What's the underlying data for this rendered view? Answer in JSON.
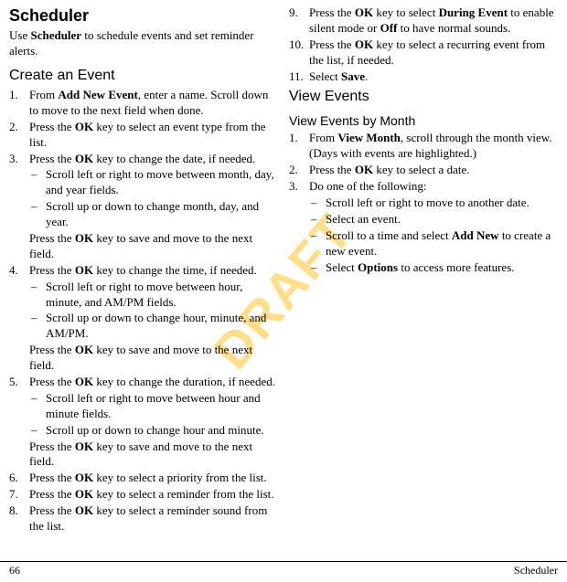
{
  "watermark": "DRAFT",
  "h1": "Scheduler",
  "intro_a": "Use ",
  "intro_b": "Scheduler",
  "intro_c": " to schedule events and set reminder alerts.",
  "h2_create": "Create an Event",
  "s1": {
    "num": "1.",
    "a": "From ",
    "b": "Add New Event",
    "c": ", enter a name. Scroll down to move to the next field when done."
  },
  "s2": {
    "num": "2.",
    "a": "Press the ",
    "b": "OK",
    "c": " key to select an event type from the list."
  },
  "s3": {
    "num": "3.",
    "a": "Press the ",
    "b": "OK",
    "c": " key to change the date, if needed."
  },
  "s3_sub1": "Scroll left or right to move between month, day, and year fields.",
  "s3_sub2": "Scroll up or down to change month, day, and year.",
  "s3_cont_a": "Press the ",
  "s3_cont_b": "OK",
  "s3_cont_c": " key to save and move to the next field.",
  "s4": {
    "num": "4.",
    "a": "Press the ",
    "b": "OK",
    "c": " key to change the time, if needed."
  },
  "s4_sub1": "Scroll left or right to move between hour, minute, and AM/PM fields.",
  "s4_sub2": "Scroll up or down to change hour, minute, and AM/PM.",
  "s4_cont_a": "Press the ",
  "s4_cont_b": "OK",
  "s4_cont_c": " key to save and move to the next field.",
  "s5": {
    "num": "5.",
    "a": "Press the ",
    "b": "OK",
    "c": " key to change the duration, if needed."
  },
  "s5_sub1": "Scroll left or right to move between hour and minute fields.",
  "s5_sub2": "Scroll up or down to change hour and minute.",
  "s5_cont_a": "Press the ",
  "s5_cont_b": "OK",
  "s5_cont_c": " key to save and move to the next field.",
  "s6": {
    "num": "6.",
    "a": "Press the ",
    "b": "OK",
    "c": " key to select a priority from the list."
  },
  "s7": {
    "num": "7.",
    "a": "Press the ",
    "b": "OK",
    "c": " key to select a reminder from the list."
  },
  "s8": {
    "num": "8.",
    "a": "Press the ",
    "b": "OK",
    "c": " key to select a reminder sound from the list."
  },
  "s9": {
    "num": "9.",
    "a": "Press the ",
    "b": "OK",
    "c": " key to select ",
    "d": "During Event",
    "e": " to enable silent mode or ",
    "f": "Off",
    "g": " to have normal sounds."
  },
  "s10": {
    "num": "10.",
    "a": "Press the ",
    "b": "OK",
    "c": " key to select a recurring event from the list, if needed."
  },
  "s11": {
    "num": "11.",
    "a": "Select ",
    "b": "Save",
    "c": "."
  },
  "h2_view": "View Events",
  "h3_month": "View Events by Month",
  "v1": {
    "num": "1.",
    "a": "From ",
    "b": "View Month",
    "c": ", scroll through the month view. (Days with events are highlighted.)"
  },
  "v2": {
    "num": "2.",
    "a": "Press the ",
    "b": "OK",
    "c": " key to select a date."
  },
  "v3": {
    "num": "3.",
    "a": "Do one of the following:"
  },
  "v3_sub1": "Scroll left or right to move to another date.",
  "v3_sub2": "Select an event.",
  "v3_sub3_a": "Scroll to a time and select ",
  "v3_sub3_b": "Add New",
  "v3_sub3_c": " to create a new event.",
  "v3_sub4_a": "Select ",
  "v3_sub4_b": "Options",
  "v3_sub4_c": " to access more features.",
  "dash": "–",
  "footer_page": "66",
  "footer_title": "Scheduler"
}
